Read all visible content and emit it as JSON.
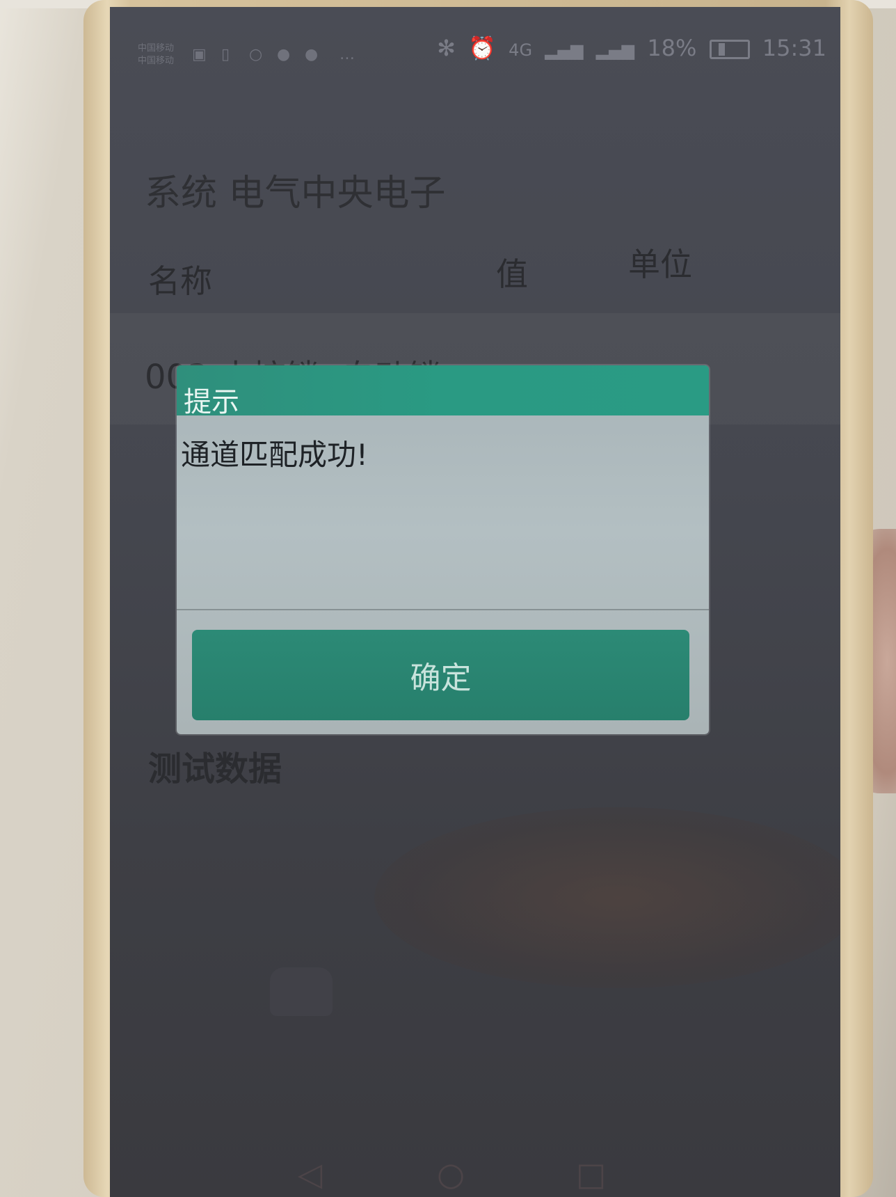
{
  "status_bar": {
    "carrier_1": "中国移动",
    "carrier_2": "中国移动",
    "icons_left": [
      "notification-icon",
      "sim-icon",
      "message-icon",
      "wechat-icon",
      "wechat-icon-2",
      "more-icon"
    ],
    "bluetooth": "✻",
    "alarm": "⏰",
    "network": "4G",
    "battery_percent": "18%",
    "time": "15:31"
  },
  "app": {
    "title": "",
    "subtitle": "系统  电气中央电子",
    "list_header": {
      "name": "名称",
      "value": "值",
      "unit": "单位"
    },
    "rows": [
      {
        "name": "003.中控锁:  自动锁",
        "value": "",
        "sub": ""
      }
    ],
    "test_data_label": "测试数据",
    "test_data_value": ""
  },
  "dialog": {
    "title": "提示",
    "message": "通道匹配成功!",
    "confirm_label": "确定"
  },
  "nav": {
    "back": "◁",
    "home": "○",
    "recent": "□"
  },
  "colors": {
    "dialog_accent": "#2a9a83",
    "screen_bg": "#45474f"
  }
}
